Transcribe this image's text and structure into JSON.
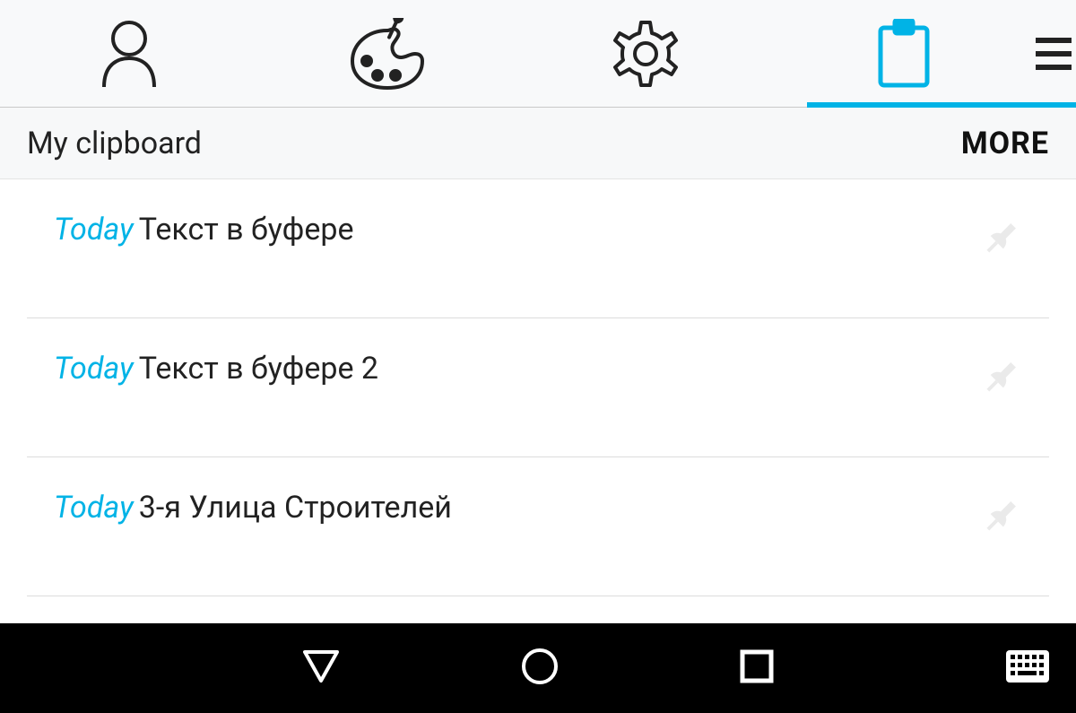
{
  "tabs": {
    "active_index": 3
  },
  "subheader": {
    "title": "My clipboard",
    "more_label": "MORE"
  },
  "items": [
    {
      "date": "Today",
      "text": "Текст в буфере"
    },
    {
      "date": "Today",
      "text": "Текст в буфере 2"
    },
    {
      "date": "Today",
      "text": "3-я Улица Строителей"
    }
  ]
}
